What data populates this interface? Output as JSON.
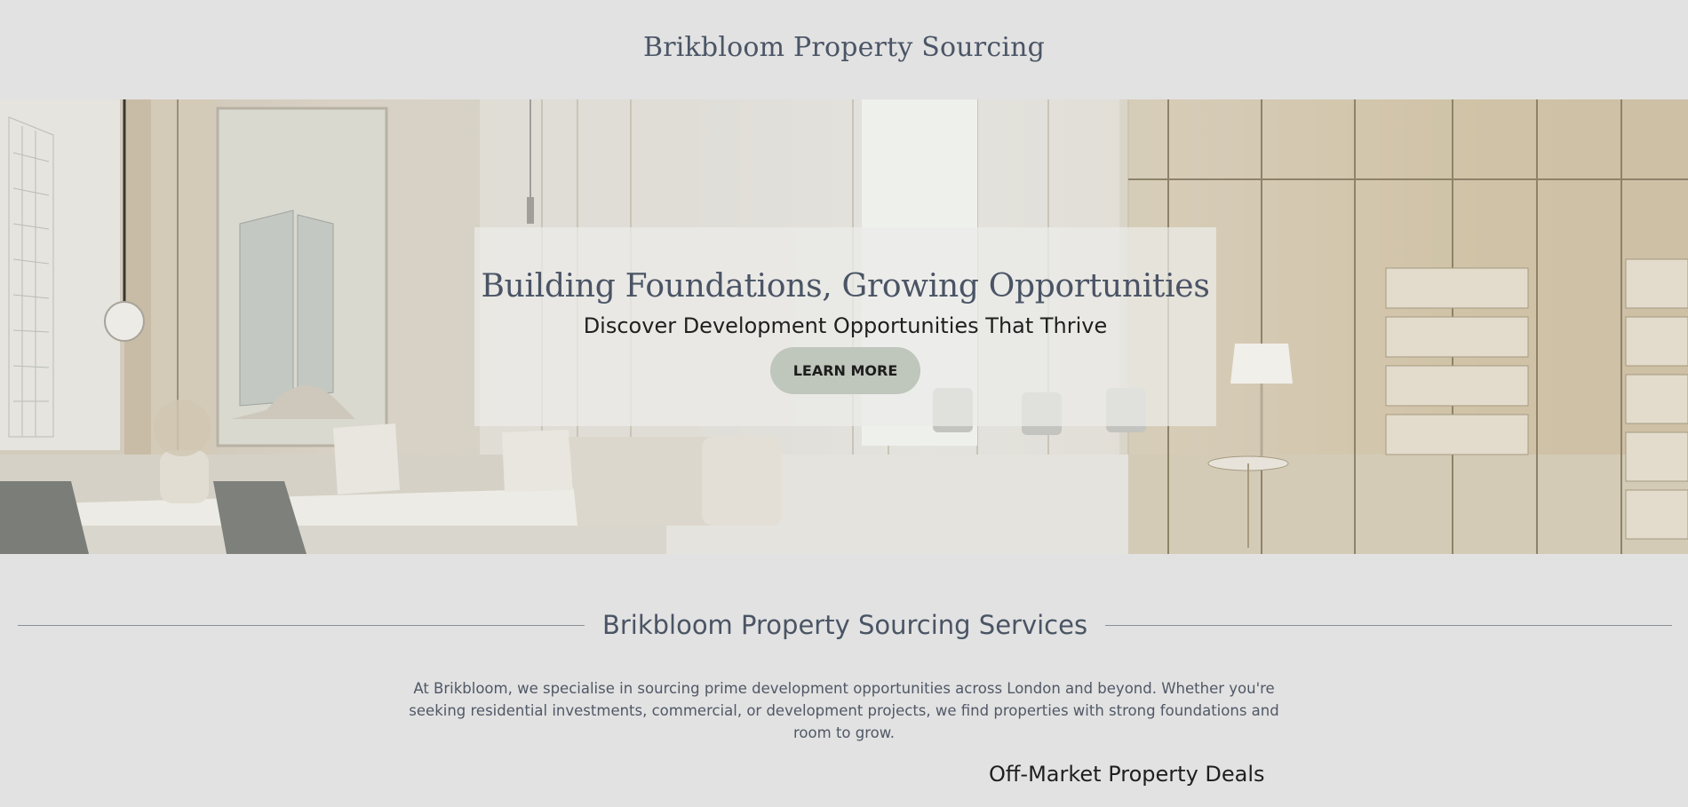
{
  "header": {
    "site_title": "Brikbloom Property Sourcing"
  },
  "hero": {
    "heading": "Building Foundations, Growing Opportunities",
    "subheading": "Discover Development Opportunities That Thrive",
    "cta_label": "LEARN MORE",
    "image_description_icon": "office-interior-image"
  },
  "services": {
    "heading": "Brikbloom Property Sourcing Services",
    "description": "At Brikbloom, we specialise in sourcing prime development opportunities across London and beyond. Whether you're seeking residential investments, commercial, or development projects, we find properties with strong foundations and room to grow.",
    "first_service_title": "Off-Market Property Deals"
  },
  "colors": {
    "page_background": "#e2e2e2",
    "heading_text": "#4a5465",
    "button_background": "#bfc6bc"
  }
}
